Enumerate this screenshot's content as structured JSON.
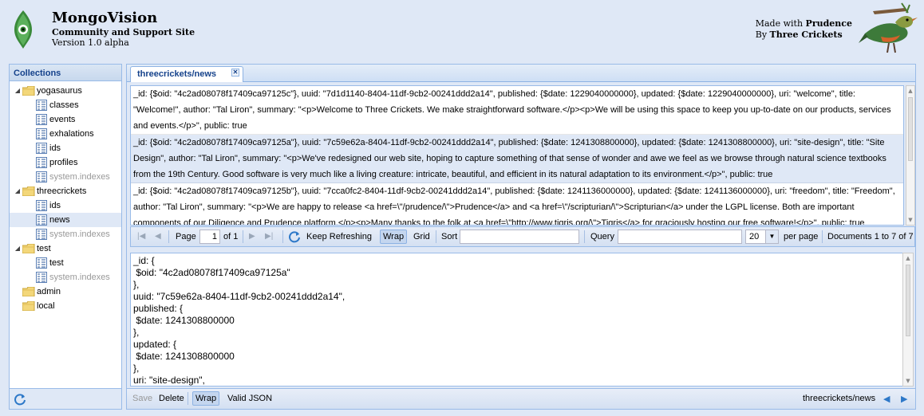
{
  "header": {
    "title": "MongoVision",
    "subtitle": "Community and Support Site",
    "version": "Version 1.0 alpha",
    "made_with_prefix": "Made with",
    "made_with_name": "Prudence",
    "by_prefix": "By",
    "by_name": "Three Crickets"
  },
  "collections": {
    "title": "Collections",
    "tree": [
      {
        "label": "yogasaurus",
        "type": "db",
        "expanded": true
      },
      {
        "label": "classes",
        "type": "coll"
      },
      {
        "label": "events",
        "type": "coll"
      },
      {
        "label": "exhalations",
        "type": "coll"
      },
      {
        "label": "ids",
        "type": "coll"
      },
      {
        "label": "profiles",
        "type": "coll"
      },
      {
        "label": "system.indexes",
        "type": "coll-dim"
      },
      {
        "label": "threecrickets",
        "type": "db",
        "expanded": true
      },
      {
        "label": "ids",
        "type": "coll"
      },
      {
        "label": "news",
        "type": "coll",
        "selected": true
      },
      {
        "label": "system.indexes",
        "type": "coll-dim"
      },
      {
        "label": "test",
        "type": "db",
        "expanded": true
      },
      {
        "label": "test",
        "type": "coll"
      },
      {
        "label": "system.indexes",
        "type": "coll-dim"
      },
      {
        "label": "admin",
        "type": "db-leaf"
      },
      {
        "label": "local",
        "type": "db-leaf"
      }
    ]
  },
  "tab": {
    "label": "threecrickets/news"
  },
  "documents": [
    "_id: {$oid: \"4c2ad08078f17409ca97125c\"}, uuid: \"7d1d1140-8404-11df-9cb2-00241ddd2a14\", published: {$date: 1229040000000}, updated: {$date: 1229040000000}, uri: \"welcome\", title: \"Welcome!\", author: \"Tal Liron\", summary: \"<p>Welcome to Three Crickets. We make straightforward software.</p><p>We will be using this space to keep you up-to-date on our products, services and events.</p>\", public: true",
    "_id: {$oid: \"4c2ad08078f17409ca97125a\"}, uuid: \"7c59e62a-8404-11df-9cb2-00241ddd2a14\", published: {$date: 1241308800000}, updated: {$date: 1241308800000}, uri: \"site-design\", title: \"Site Design\", author: \"Tal Liron\", summary: \"<p>We've redesigned our web site, hoping to capture something of that sense of wonder and awe we feel as we browse through natural science textbooks from the 19th Century. Good software is very much like a living creature: intricate, beautiful, and efficient in its natural adaptation to its environment.</p>\", public: true",
    "_id: {$oid: \"4c2ad08078f17409ca97125b\"}, uuid: \"7cca0fc2-8404-11df-9cb2-00241ddd2a14\", published: {$date: 1241136000000}, updated: {$date: 1241136000000}, uri: \"freedom\", title: \"Freedom\", author: \"Tal Liron\", summary: \"<p>We are happy to release <a href=\\\"/prudence/\\\">Prudence</a> and <a href=\\\"/scripturian/\\\">Scripturian</a> under the LGPL license. Both are important components of our Diligence and Prudence platform.</p><p>Many thanks to the folk at <a href=\\\"http://www.tigris.org/\\\">Tigris</a> for graciously hosting our free software!</p>\", public: true"
  ],
  "selected_document_index": 1,
  "list_toolbar": {
    "page_label": "Page",
    "page_value": "1",
    "of_label": "of 1",
    "keep_refreshing": "Keep Refreshing",
    "wrap": "Wrap",
    "grid": "Grid",
    "sort": "Sort",
    "sort_value": "",
    "query": "Query",
    "query_value": "",
    "per_page_value": "20",
    "per_page_label": "per page",
    "documents_info": "Documents 1 to 7 of 7"
  },
  "detail": {
    "json_lines": [
      "_id: {",
      " $oid: \"4c2ad08078f17409ca97125a\"",
      "},",
      "uuid: \"7c59e62a-8404-11df-9cb2-00241ddd2a14\",",
      "published: {",
      " $date: 1241308800000",
      "},",
      "updated: {",
      " $date: 1241308800000",
      "},",
      "uri: \"site-design\","
    ]
  },
  "detail_toolbar": {
    "save": "Save",
    "delete": "Delete",
    "wrap": "Wrap",
    "valid_json": "Valid JSON",
    "location": "threecrickets/news"
  },
  "colors": {
    "panel_border": "#99bbe8",
    "header_text": "#15428b",
    "selection": "#dfe8f6",
    "background": "#dfe8f6"
  }
}
